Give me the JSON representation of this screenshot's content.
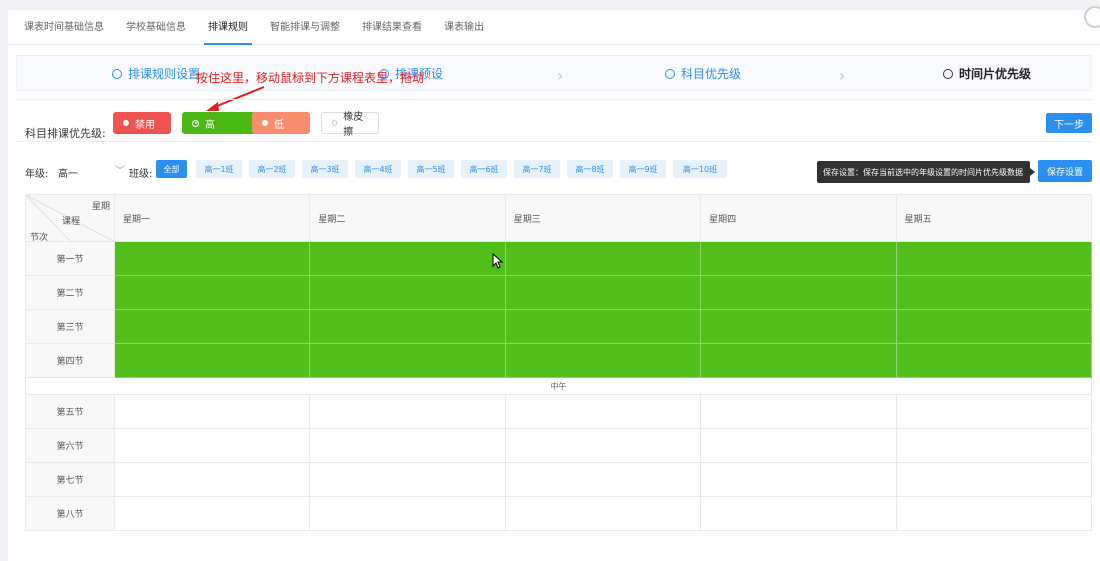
{
  "tabs": [
    "课表时间基础信息",
    "学校基础信息",
    "排课规则",
    "智能排课与调整",
    "排课结果查看",
    "课表输出"
  ],
  "active_tab": "排课规则",
  "steps": {
    "s1": "排课规则设置",
    "s2": "排课预设",
    "s3": "科目优先级",
    "s4": "时间片优先级"
  },
  "annotation": "按住这里，移动鼠标到下方课程表里，拖动",
  "priority": {
    "label": "科目排课优先级:",
    "disable": "禁用",
    "high": "高",
    "low": "低",
    "eraser": "橡皮擦",
    "next": "下一步"
  },
  "filter": {
    "grade_label": "年级:",
    "grade_value": "高一",
    "class_label": "班级:",
    "classes": [
      "全部",
      "高一1班",
      "高一2班",
      "高一3班",
      "高一4班",
      "高一5班",
      "高一6班",
      "高一7班",
      "高一8班",
      "高一9班",
      "高一10班"
    ],
    "tooltip": "保存设置：保存当前选中的年级设置的时间片优先级数据",
    "save": "保存设置"
  },
  "table": {
    "corner": {
      "top": "星期",
      "middle": "课程",
      "bottom": "节次"
    },
    "days": [
      "星期一",
      "星期二",
      "星期三",
      "星期四",
      "星期五"
    ],
    "morning": [
      "第一节",
      "第二节",
      "第三节",
      "第四节"
    ],
    "noon": "中午",
    "afternoon": [
      "第五节",
      "第六节",
      "第七节",
      "第八节"
    ]
  },
  "colors": {
    "accent": "#2b8ff0",
    "high": "#52be1c",
    "disable": "#ef5350",
    "low": "#f88d6e",
    "annotation": "#e02020"
  }
}
